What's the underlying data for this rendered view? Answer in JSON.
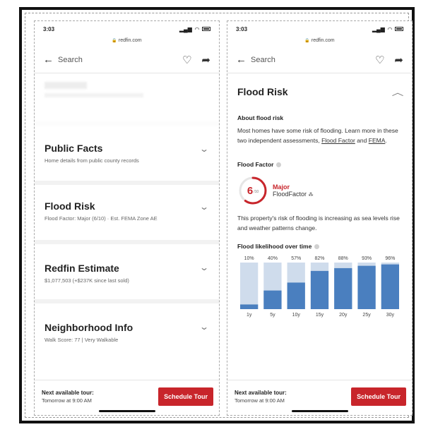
{
  "left": {
    "status": {
      "time": "3:03",
      "url": "redfin.com"
    },
    "nav": {
      "back_label": "Search"
    },
    "sections": [
      {
        "title": "Public Facts",
        "subtitle": "Home details from public county records"
      },
      {
        "title": "Flood Risk",
        "subtitle": "Flood Factor: Major (6/10) · Est. FEMA Zone AE"
      },
      {
        "title": "Redfin Estimate",
        "subtitle": "$1,077,503 (+$237K since last sold)"
      },
      {
        "title": "Neighborhood Info",
        "subtitle": "Walk Score: 77 | Very Walkable"
      }
    ],
    "cta": {
      "label": "Next available tour:",
      "time": "Tomorrow at 9:00 AM",
      "button": "Schedule Tour"
    }
  },
  "right": {
    "status": {
      "time": "3:03",
      "url": "redfin.com"
    },
    "nav": {
      "back_label": "Search"
    },
    "flood": {
      "title": "Flood Risk",
      "about_title": "About flood risk",
      "about_text": "Most homes have some risk of flooding. Learn more in these two independent assessments,",
      "link_ff": "Flood Factor",
      "and_text": "and",
      "link_fema": "FEMA",
      "ff_title": "Flood Factor",
      "ff_score": "6",
      "ff_out_of": "/10",
      "ff_severity": "Major",
      "ff_brand": "FloodFactor",
      "ff_desc": "This property's risk of flooding is increasing as sea levels rise and weather patterns change.",
      "likelihood_title": "Flood likelihood over time"
    },
    "cta": {
      "label": "Next available tour:",
      "time": "Tomorrow at 9:00 AM",
      "button": "Schedule Tour"
    }
  },
  "colors": {
    "accent": "#c8252b",
    "bar": "#4a7fbf",
    "bar_bg": "#cfdcec"
  },
  "chart_data": {
    "type": "bar",
    "title": "Flood likelihood over time",
    "categories": [
      "1y",
      "5y",
      "10y",
      "15y",
      "20y",
      "25y",
      "30y"
    ],
    "values": [
      10,
      40,
      57,
      82,
      88,
      93,
      96
    ],
    "value_labels": [
      "10%",
      "40%",
      "57%",
      "82%",
      "88%",
      "93%",
      "96%"
    ],
    "ylim": [
      0,
      100
    ],
    "grid": false
  }
}
